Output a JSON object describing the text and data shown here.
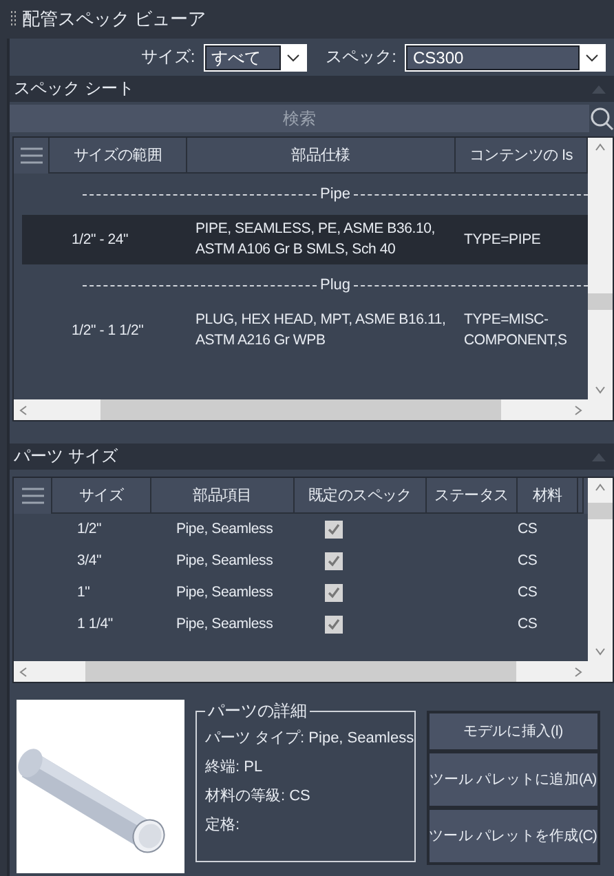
{
  "window": {
    "title": "配管スペック ビューア"
  },
  "filters": [
    {
      "label": "サイズ:",
      "value": "すべて",
      "kind": "short"
    },
    {
      "label": "スペック:",
      "value": "CS300",
      "kind": "long"
    }
  ],
  "spec_sheet": {
    "title": "スペック シート",
    "search": {
      "placeholder": "検索"
    },
    "columns": [
      "サイズの範囲",
      "部品仕様",
      "コンテンツの Is"
    ],
    "rows": [
      {
        "kind": "group",
        "label": "Pipe"
      },
      {
        "kind": "item",
        "selected": true,
        "cells": [
          "1/2\" - 24\"",
          "PIPE, SEAMLESS, PE, ASME B36.10, ASTM A106 Gr B SMLS, Sch 40",
          "TYPE=PIPE"
        ]
      },
      {
        "kind": "group",
        "label": "Plug"
      },
      {
        "kind": "item",
        "selected": false,
        "cells": [
          "1/2\" - 1 1/2\"",
          "PLUG, HEX HEAD, MPT, ASME B16.11, ASTM A216 Gr WPB",
          "TYPE=MISC-COMPONENT,S"
        ]
      }
    ]
  },
  "part_sizes": {
    "title": "パーツ サイズ",
    "columns": [
      "サイズ",
      "部品項目",
      "既定のスペック",
      "ステータス",
      "材料"
    ],
    "rows": [
      {
        "size": "1/2\"",
        "item": "Pipe, Seamless",
        "checked": true,
        "material": "CS"
      },
      {
        "size": "3/4\"",
        "item": "Pipe, Seamless",
        "checked": true,
        "material": "CS"
      },
      {
        "size": "1\"",
        "item": "Pipe, Seamless",
        "checked": true,
        "material": "CS"
      },
      {
        "size": "1 1/4\"",
        "item": "Pipe, Seamless",
        "checked": true,
        "material": "CS"
      }
    ]
  },
  "details": {
    "title": "パーツの詳細",
    "lines": [
      "パーツ タイプ: Pipe, Seamless",
      "終端: PL",
      "材料の等級: CS",
      "定格:"
    ]
  },
  "buttons": [
    "モデルに挿入(I)",
    "ツール パレットに追加(A)",
    "ツール パレットを作成(C)"
  ]
}
